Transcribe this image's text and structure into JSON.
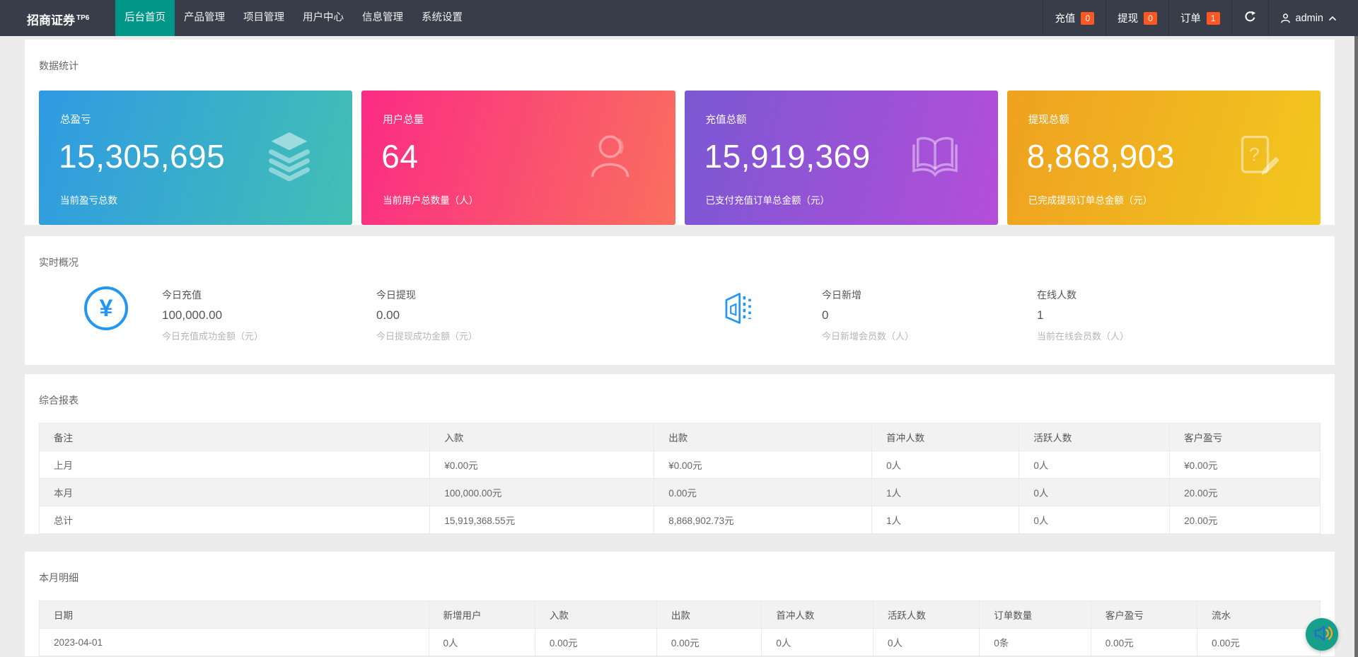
{
  "navbar": {
    "brand": "招商证券",
    "brand_sup": "TP6",
    "menu": [
      {
        "label": "后台首页",
        "active": true
      },
      {
        "label": "产品管理",
        "active": false
      },
      {
        "label": "项目管理",
        "active": false
      },
      {
        "label": "用户中心",
        "active": false
      },
      {
        "label": "信息管理",
        "active": false
      },
      {
        "label": "系统设置",
        "active": false
      }
    ],
    "right_items": [
      {
        "label": "充值",
        "count": "0"
      },
      {
        "label": "提现",
        "count": "0"
      },
      {
        "label": "订单",
        "count": "1"
      }
    ],
    "username": "admin"
  },
  "stats_section": {
    "title": "数据统计",
    "cards": [
      {
        "title": "总盈亏",
        "value": "15,305,695",
        "desc": "当前盈亏总数",
        "icon": "layers-icon",
        "gradient": [
          "#2f9ae3",
          "#42c0b4"
        ]
      },
      {
        "title": "用户总量",
        "value": "64",
        "desc": "当前用户总数量（人）",
        "icon": "user-icon",
        "gradient": [
          "#fb2b85",
          "#fa6f5e"
        ]
      },
      {
        "title": "充值总额",
        "value": "15,919,369",
        "desc": "已支付充值订单总金额（元）",
        "icon": "open-book-icon",
        "gradient": [
          "#7a58d3",
          "#b44ed9"
        ]
      },
      {
        "title": "提现总额",
        "value": "8,868,903",
        "desc": "已完成提现订单总金额（元）",
        "icon": "document-edit-icon",
        "gradient": [
          "#efa120",
          "#f2c71f"
        ]
      }
    ]
  },
  "realtime_section": {
    "title": "实时概况",
    "icons": [
      "yuan-circle-icon",
      "building-icon"
    ],
    "stats": [
      {
        "label": "今日充值",
        "value": "100,000.00",
        "desc": "今日充值成功金额（元）"
      },
      {
        "label": "今日提现",
        "value": "0.00",
        "desc": "今日提现成功金额（元）"
      },
      {
        "label": "今日新增",
        "value": "0",
        "desc": "今日新增会员数（人）"
      },
      {
        "label": "在线人数",
        "value": "1",
        "desc": "当前在线会员数（人）"
      }
    ]
  },
  "report_section": {
    "title": "综合报表",
    "headers": [
      "备注",
      "入款",
      "出款",
      "首冲人数",
      "活跃人数",
      "客户盈亏"
    ],
    "rows": [
      [
        "上月",
        "¥0.00元",
        "¥0.00元",
        "0人",
        "0人",
        "¥0.00元"
      ],
      [
        "本月",
        "100,000.00元",
        "0.00元",
        "1人",
        "0人",
        "20.00元"
      ],
      [
        "总计",
        "15,919,368.55元",
        "8,868,902.73元",
        "1人",
        "0人",
        "20.00元"
      ]
    ]
  },
  "detail_section": {
    "title": "本月明细",
    "headers": [
      "日期",
      "新增用户",
      "入款",
      "出款",
      "首冲人数",
      "活跃人数",
      "订单数量",
      "客户盈亏",
      "流水"
    ],
    "rows": [
      [
        "2023-04-01",
        "0人",
        "0.00元",
        "0.00元",
        "0人",
        "0人",
        "0条",
        "0.00元",
        "0.00元"
      ]
    ]
  },
  "colors": {
    "navbar_bg": "#373d49",
    "active_menu": "#009688",
    "badge": "#ff5722",
    "accent_blue": "#2196f3",
    "fab_bg": "#16a08c",
    "fab_speaker": "#2f66d0",
    "fab_waves": "#f5a623",
    "page_bg": "#ececec",
    "table_header_bg": "#f2f2f2"
  }
}
